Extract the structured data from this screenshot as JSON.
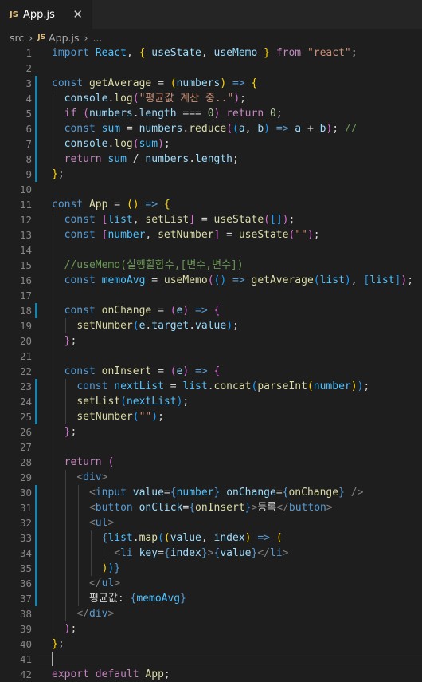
{
  "tab": {
    "badge": "JS",
    "filename": "App.js",
    "close": "✕"
  },
  "breadcrumb": {
    "folder": "src",
    "badge": "JS",
    "file": "App.js",
    "more": "..."
  },
  "lines": [
    {
      "n": "1",
      "t": [
        [
          "kw",
          "import "
        ],
        [
          "cn",
          "React"
        ],
        [
          "p",
          ", "
        ],
        [
          "br1",
          "{"
        ],
        [
          "p",
          " "
        ],
        [
          "vr",
          "useState"
        ],
        [
          "p",
          ", "
        ],
        [
          "vr",
          "useMemo"
        ],
        [
          "p",
          " "
        ],
        [
          "br1",
          "}"
        ],
        [
          "p",
          " "
        ],
        [
          "cf",
          "from"
        ],
        [
          "p",
          " "
        ],
        [
          "st",
          "\"react\""
        ],
        [
          "p",
          ";"
        ]
      ]
    },
    {
      "n": "2",
      "t": []
    },
    {
      "n": "3",
      "t": [
        [
          "kw",
          "const "
        ],
        [
          "fn",
          "getAverage"
        ],
        [
          "p",
          " = "
        ],
        [
          "br1",
          "("
        ],
        [
          "vr",
          "numbers"
        ],
        [
          "br1",
          ")"
        ],
        [
          "p",
          " "
        ],
        [
          "kw",
          "=>"
        ],
        [
          "p",
          " "
        ],
        [
          "br1",
          "{"
        ]
      ]
    },
    {
      "n": "4",
      "t": [
        [
          "p",
          "  "
        ],
        [
          "vr",
          "console"
        ],
        [
          "p",
          "."
        ],
        [
          "fn",
          "log"
        ],
        [
          "br2",
          "("
        ],
        [
          "st",
          "\"평균값 계산 중..\""
        ],
        [
          "br2",
          ")"
        ],
        [
          "p",
          ";"
        ]
      ]
    },
    {
      "n": "5",
      "t": [
        [
          "p",
          "  "
        ],
        [
          "cf",
          "if"
        ],
        [
          "p",
          " "
        ],
        [
          "br2",
          "("
        ],
        [
          "vr",
          "numbers"
        ],
        [
          "p",
          "."
        ],
        [
          "vr",
          "length"
        ],
        [
          "p",
          " === "
        ],
        [
          "nm",
          "0"
        ],
        [
          "br2",
          ")"
        ],
        [
          "p",
          " "
        ],
        [
          "cf",
          "return"
        ],
        [
          "p",
          " "
        ],
        [
          "nm",
          "0"
        ],
        [
          "p",
          ";"
        ]
      ]
    },
    {
      "n": "6",
      "t": [
        [
          "p",
          "  "
        ],
        [
          "kw",
          "const "
        ],
        [
          "cn",
          "sum"
        ],
        [
          "p",
          " = "
        ],
        [
          "vr",
          "numbers"
        ],
        [
          "p",
          "."
        ],
        [
          "fn",
          "reduce"
        ],
        [
          "br2",
          "("
        ],
        [
          "br3",
          "("
        ],
        [
          "vr",
          "a"
        ],
        [
          "p",
          ", "
        ],
        [
          "vr",
          "b"
        ],
        [
          "br3",
          ")"
        ],
        [
          "p",
          " "
        ],
        [
          "kw",
          "=>"
        ],
        [
          "p",
          " "
        ],
        [
          "vr",
          "a"
        ],
        [
          "p",
          " + "
        ],
        [
          "vr",
          "b"
        ],
        [
          "br2",
          ")"
        ],
        [
          "p",
          "; "
        ],
        [
          "cm",
          "//"
        ]
      ]
    },
    {
      "n": "7",
      "t": [
        [
          "p",
          "  "
        ],
        [
          "vr",
          "console"
        ],
        [
          "p",
          "."
        ],
        [
          "fn",
          "log"
        ],
        [
          "br2",
          "("
        ],
        [
          "cn",
          "sum"
        ],
        [
          "br2",
          ")"
        ],
        [
          "p",
          ";"
        ]
      ]
    },
    {
      "n": "8",
      "t": [
        [
          "p",
          "  "
        ],
        [
          "cf",
          "return"
        ],
        [
          "p",
          " "
        ],
        [
          "cn",
          "sum"
        ],
        [
          "p",
          " / "
        ],
        [
          "vr",
          "numbers"
        ],
        [
          "p",
          "."
        ],
        [
          "vr",
          "length"
        ],
        [
          "p",
          ";"
        ]
      ]
    },
    {
      "n": "9",
      "t": [
        [
          "br1",
          "}"
        ],
        [
          "p",
          ";"
        ]
      ]
    },
    {
      "n": "10",
      "t": []
    },
    {
      "n": "11",
      "t": [
        [
          "kw",
          "const "
        ],
        [
          "fn",
          "App"
        ],
        [
          "p",
          " = "
        ],
        [
          "br1",
          "("
        ],
        [
          "br1",
          ")"
        ],
        [
          "p",
          " "
        ],
        [
          "kw",
          "=>"
        ],
        [
          "p",
          " "
        ],
        [
          "br1",
          "{"
        ]
      ]
    },
    {
      "n": "12",
      "t": [
        [
          "p",
          "  "
        ],
        [
          "kw",
          "const "
        ],
        [
          "br2",
          "["
        ],
        [
          "cn",
          "list"
        ],
        [
          "p",
          ", "
        ],
        [
          "fn",
          "setList"
        ],
        [
          "br2",
          "]"
        ],
        [
          "p",
          " = "
        ],
        [
          "fn",
          "useState"
        ],
        [
          "br2",
          "("
        ],
        [
          "br3",
          "["
        ],
        [
          "br3",
          "]"
        ],
        [
          "br2",
          ")"
        ],
        [
          "p",
          ";"
        ]
      ]
    },
    {
      "n": "13",
      "t": [
        [
          "p",
          "  "
        ],
        [
          "kw",
          "const "
        ],
        [
          "br2",
          "["
        ],
        [
          "cn",
          "number"
        ],
        [
          "p",
          ", "
        ],
        [
          "fn",
          "setNumber"
        ],
        [
          "br2",
          "]"
        ],
        [
          "p",
          " = "
        ],
        [
          "fn",
          "useState"
        ],
        [
          "br2",
          "("
        ],
        [
          "st",
          "\"\""
        ],
        [
          "br2",
          ")"
        ],
        [
          "p",
          ";"
        ]
      ]
    },
    {
      "n": "14",
      "t": []
    },
    {
      "n": "15",
      "t": [
        [
          "p",
          "  "
        ],
        [
          "cm",
          "//useMemo(실행할함수,[변수,변수])"
        ]
      ]
    },
    {
      "n": "16",
      "t": [
        [
          "p",
          "  "
        ],
        [
          "kw",
          "const "
        ],
        [
          "cn",
          "memoAvg"
        ],
        [
          "p",
          " = "
        ],
        [
          "fn",
          "useMemo"
        ],
        [
          "br2",
          "("
        ],
        [
          "br3",
          "("
        ],
        [
          "br3",
          ")"
        ],
        [
          "p",
          " "
        ],
        [
          "kw",
          "=>"
        ],
        [
          "p",
          " "
        ],
        [
          "fn",
          "getAverage"
        ],
        [
          "br3",
          "("
        ],
        [
          "cn",
          "list"
        ],
        [
          "br3",
          ")"
        ],
        [
          "p",
          ", "
        ],
        [
          "br3",
          "["
        ],
        [
          "cn",
          "list"
        ],
        [
          "br3",
          "]"
        ],
        [
          "br2",
          ")"
        ],
        [
          "p",
          ";"
        ]
      ]
    },
    {
      "n": "17",
      "t": []
    },
    {
      "n": "18",
      "t": [
        [
          "p",
          "  "
        ],
        [
          "kw",
          "const "
        ],
        [
          "fn",
          "onChange"
        ],
        [
          "p",
          " = "
        ],
        [
          "br2",
          "("
        ],
        [
          "vr",
          "e"
        ],
        [
          "br2",
          ")"
        ],
        [
          "p",
          " "
        ],
        [
          "kw",
          "=>"
        ],
        [
          "p",
          " "
        ],
        [
          "br2",
          "{"
        ]
      ]
    },
    {
      "n": "19",
      "t": [
        [
          "p",
          "    "
        ],
        [
          "fn",
          "setNumber"
        ],
        [
          "br3",
          "("
        ],
        [
          "vr",
          "e"
        ],
        [
          "p",
          "."
        ],
        [
          "vr",
          "target"
        ],
        [
          "p",
          "."
        ],
        [
          "vr",
          "value"
        ],
        [
          "br3",
          ")"
        ],
        [
          "p",
          ";"
        ]
      ]
    },
    {
      "n": "20",
      "t": [
        [
          "p",
          "  "
        ],
        [
          "br2",
          "}"
        ],
        [
          "p",
          ";"
        ]
      ]
    },
    {
      "n": "21",
      "t": []
    },
    {
      "n": "22",
      "t": [
        [
          "p",
          "  "
        ],
        [
          "kw",
          "const "
        ],
        [
          "fn",
          "onInsert"
        ],
        [
          "p",
          " = "
        ],
        [
          "br2",
          "("
        ],
        [
          "vr",
          "e"
        ],
        [
          "br2",
          ")"
        ],
        [
          "p",
          " "
        ],
        [
          "kw",
          "=>"
        ],
        [
          "p",
          " "
        ],
        [
          "br2",
          "{"
        ]
      ]
    },
    {
      "n": "23",
      "t": [
        [
          "p",
          "    "
        ],
        [
          "kw",
          "const "
        ],
        [
          "cn",
          "nextList"
        ],
        [
          "p",
          " = "
        ],
        [
          "cn",
          "list"
        ],
        [
          "p",
          "."
        ],
        [
          "fn",
          "concat"
        ],
        [
          "br3",
          "("
        ],
        [
          "fn",
          "parseInt"
        ],
        [
          "br1",
          "("
        ],
        [
          "cn",
          "number"
        ],
        [
          "br1",
          ")"
        ],
        [
          "br3",
          ")"
        ],
        [
          "p",
          ";"
        ]
      ]
    },
    {
      "n": "24",
      "t": [
        [
          "p",
          "    "
        ],
        [
          "fn",
          "setList"
        ],
        [
          "br3",
          "("
        ],
        [
          "cn",
          "nextList"
        ],
        [
          "br3",
          ")"
        ],
        [
          "p",
          ";"
        ]
      ]
    },
    {
      "n": "25",
      "t": [
        [
          "p",
          "    "
        ],
        [
          "fn",
          "setNumber"
        ],
        [
          "br3",
          "("
        ],
        [
          "st",
          "\"\""
        ],
        [
          "br3",
          ")"
        ],
        [
          "p",
          ";"
        ]
      ]
    },
    {
      "n": "26",
      "t": [
        [
          "p",
          "  "
        ],
        [
          "br2",
          "}"
        ],
        [
          "p",
          ";"
        ]
      ]
    },
    {
      "n": "27",
      "t": []
    },
    {
      "n": "28",
      "t": [
        [
          "p",
          "  "
        ],
        [
          "cf",
          "return"
        ],
        [
          "p",
          " "
        ],
        [
          "br2",
          "("
        ]
      ]
    },
    {
      "n": "29",
      "t": [
        [
          "p",
          "    "
        ],
        [
          "tb",
          "<"
        ],
        [
          "tg",
          "div"
        ],
        [
          "tb",
          ">"
        ]
      ]
    },
    {
      "n": "30",
      "t": [
        [
          "p",
          "      "
        ],
        [
          "tb",
          "<"
        ],
        [
          "tg",
          "input"
        ],
        [
          "p",
          " "
        ],
        [
          "at",
          "value"
        ],
        [
          "p",
          "="
        ],
        [
          "kw",
          "{"
        ],
        [
          "cn",
          "number"
        ],
        [
          "kw",
          "}"
        ],
        [
          "p",
          " "
        ],
        [
          "at",
          "onChange"
        ],
        [
          "p",
          "="
        ],
        [
          "kw",
          "{"
        ],
        [
          "fn",
          "onChange"
        ],
        [
          "kw",
          "}"
        ],
        [
          "p",
          " "
        ],
        [
          "tb",
          "/>"
        ]
      ]
    },
    {
      "n": "31",
      "t": [
        [
          "p",
          "      "
        ],
        [
          "tb",
          "<"
        ],
        [
          "tg",
          "button"
        ],
        [
          "p",
          " "
        ],
        [
          "at",
          "onClick"
        ],
        [
          "p",
          "="
        ],
        [
          "kw",
          "{"
        ],
        [
          "fn",
          "onInsert"
        ],
        [
          "kw",
          "}"
        ],
        [
          "tb",
          ">"
        ],
        [
          "p",
          "등록"
        ],
        [
          "tb",
          "</"
        ],
        [
          "tg",
          "button"
        ],
        [
          "tb",
          ">"
        ]
      ]
    },
    {
      "n": "32",
      "t": [
        [
          "p",
          "      "
        ],
        [
          "tb",
          "<"
        ],
        [
          "tg",
          "ul"
        ],
        [
          "tb",
          ">"
        ]
      ]
    },
    {
      "n": "33",
      "t": [
        [
          "p",
          "        "
        ],
        [
          "kw",
          "{"
        ],
        [
          "cn",
          "list"
        ],
        [
          "p",
          "."
        ],
        [
          "fn",
          "map"
        ],
        [
          "br3",
          "("
        ],
        [
          "br1",
          "("
        ],
        [
          "vr",
          "value"
        ],
        [
          "p",
          ", "
        ],
        [
          "vr",
          "index"
        ],
        [
          "br1",
          ")"
        ],
        [
          "p",
          " "
        ],
        [
          "kw",
          "=>"
        ],
        [
          "p",
          " "
        ],
        [
          "br1",
          "("
        ]
      ]
    },
    {
      "n": "34",
      "t": [
        [
          "p",
          "          "
        ],
        [
          "tb",
          "<"
        ],
        [
          "tg",
          "li"
        ],
        [
          "p",
          " "
        ],
        [
          "at",
          "key"
        ],
        [
          "p",
          "="
        ],
        [
          "kw",
          "{"
        ],
        [
          "vr",
          "index"
        ],
        [
          "kw",
          "}"
        ],
        [
          "tb",
          ">"
        ],
        [
          "kw",
          "{"
        ],
        [
          "vr",
          "value"
        ],
        [
          "kw",
          "}"
        ],
        [
          "tb",
          "</"
        ],
        [
          "tg",
          "li"
        ],
        [
          "tb",
          ">"
        ]
      ]
    },
    {
      "n": "35",
      "t": [
        [
          "p",
          "        "
        ],
        [
          "br1",
          ")"
        ],
        [
          "br3",
          ")"
        ],
        [
          "kw",
          "}"
        ]
      ]
    },
    {
      "n": "36",
      "t": [
        [
          "p",
          "      "
        ],
        [
          "tb",
          "</"
        ],
        [
          "tg",
          "ul"
        ],
        [
          "tb",
          ">"
        ]
      ]
    },
    {
      "n": "37",
      "t": [
        [
          "p",
          "      "
        ],
        [
          "p",
          "평균값: "
        ],
        [
          "kw",
          "{"
        ],
        [
          "cn",
          "memoAvg"
        ],
        [
          "kw",
          "}"
        ]
      ]
    },
    {
      "n": "38",
      "t": [
        [
          "p",
          "    "
        ],
        [
          "tb",
          "</"
        ],
        [
          "tg",
          "div"
        ],
        [
          "tb",
          ">"
        ]
      ]
    },
    {
      "n": "39",
      "t": [
        [
          "p",
          "  "
        ],
        [
          "br2",
          ")"
        ],
        [
          "p",
          ";"
        ]
      ]
    },
    {
      "n": "40",
      "t": [
        [
          "br1",
          "}"
        ],
        [
          "p",
          ";"
        ]
      ]
    },
    {
      "n": "41",
      "t": []
    },
    {
      "n": "42",
      "t": [
        [
          "cf",
          "export"
        ],
        [
          "p",
          " "
        ],
        [
          "cf",
          "default"
        ],
        [
          "p",
          " "
        ],
        [
          "fn",
          "App"
        ],
        [
          "p",
          ";"
        ]
      ]
    }
  ]
}
